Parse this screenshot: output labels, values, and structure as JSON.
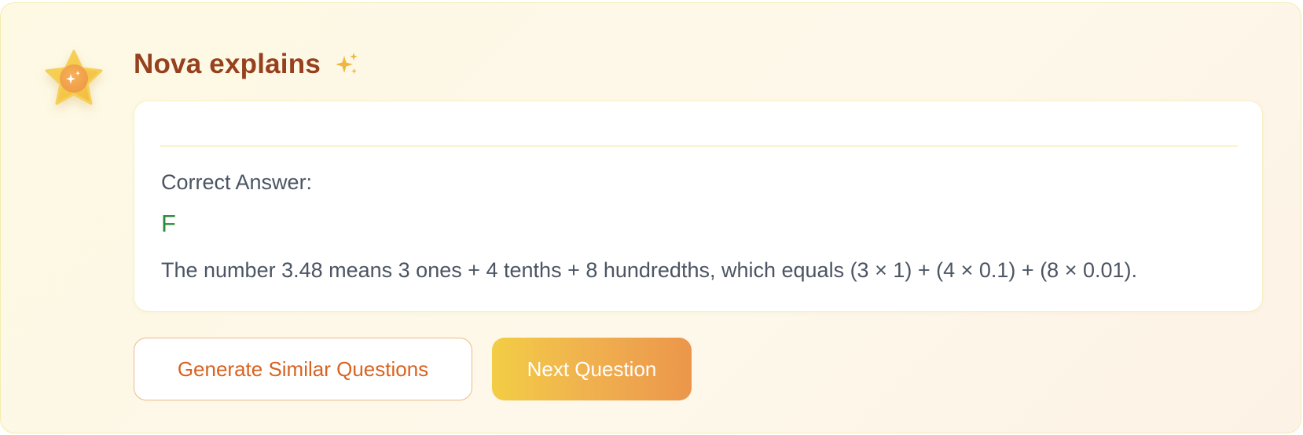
{
  "header": {
    "title": "Nova explains",
    "avatar_icon": "star-sparkle-icon",
    "title_icon": "sparkles-icon"
  },
  "answer": {
    "label": "Correct Answer:",
    "value": "F",
    "explanation": "The number 3.48 means 3 ones + 4 tenths + 8 hundredths, which equals (3 × 1) + (4 × 0.1) + (8 × 0.01)."
  },
  "actions": {
    "generate_label": "Generate Similar Questions",
    "next_label": "Next Question"
  },
  "colors": {
    "title": "#96401e",
    "correct_answer": "#2f8a3a",
    "accent_orange": "#d9621f",
    "gradient_start": "#f3cd45",
    "gradient_end": "#ec964b"
  }
}
